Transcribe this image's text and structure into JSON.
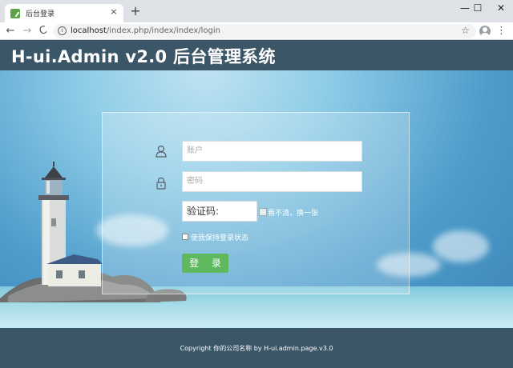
{
  "browser": {
    "tab_title": "后台登录",
    "tab_close": "×",
    "new_tab": "+",
    "window_controls": {
      "minimize": "—",
      "maximize": "☐",
      "close": "✕"
    },
    "back_glyph": "←",
    "forward_glyph": "→",
    "reload_glyph": "C",
    "url_host": "localhost",
    "url_path": "/index.php/index/index/login",
    "star_glyph": "☆",
    "menu_glyph": "⋮",
    "info_glyph": "i"
  },
  "header": {
    "title": "H-ui.Admin v2.0 后台管理系统"
  },
  "login": {
    "account_placeholder": "账户",
    "password_placeholder": "密码",
    "captcha_value": "验证码:",
    "captcha_refresh": "看不清，换一张",
    "remember_label": "使我保持登录状态",
    "submit_label": "登 录"
  },
  "footer": {
    "copyright": "Copyright 你的公司名称 by H-ui.admin.page.v3.0"
  },
  "colors": {
    "header_bg": "#3b5667",
    "button_bg": "#5eb95e",
    "favicon": "#5aa445"
  }
}
